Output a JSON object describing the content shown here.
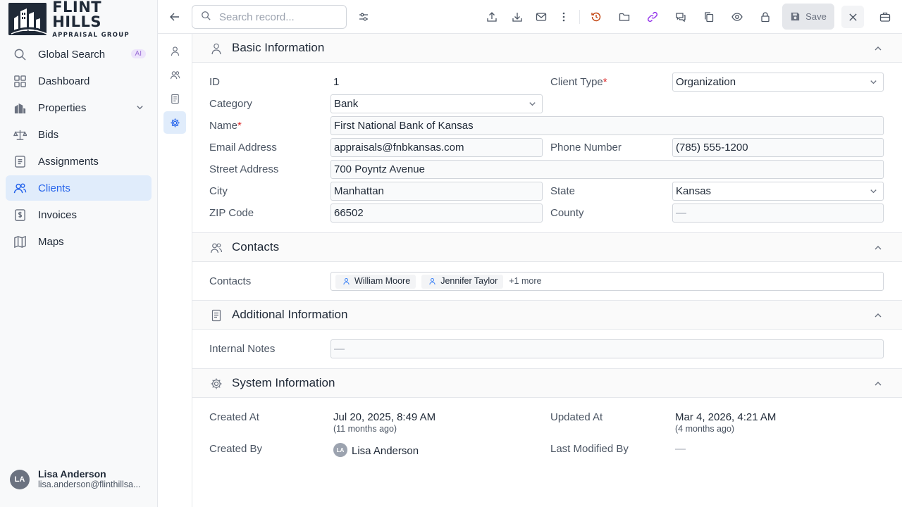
{
  "brand": {
    "title": "FLINT HILLS",
    "subtitle": "APPRAISAL GROUP"
  },
  "sidebar": {
    "items": [
      {
        "label": "Global Search",
        "icon": "search-icon",
        "badge": "AI"
      },
      {
        "label": "Dashboard",
        "icon": "dashboard-icon"
      },
      {
        "label": "Properties",
        "icon": "building-icon",
        "expandable": true
      },
      {
        "label": "Bids",
        "icon": "scale-icon"
      },
      {
        "label": "Assignments",
        "icon": "clipboard-icon"
      },
      {
        "label": "Clients",
        "icon": "users-icon",
        "active": true
      },
      {
        "label": "Invoices",
        "icon": "invoice-icon"
      },
      {
        "label": "Maps",
        "icon": "map-icon"
      }
    ],
    "user": {
      "initials": "LA",
      "name": "Lisa Anderson",
      "email": "lisa.anderson@flinthillsa..."
    }
  },
  "toolbar": {
    "search_placeholder": "Search record...",
    "save_label": "Save",
    "accent_history": "#c2410c",
    "accent_link": "#9333ea"
  },
  "sections": {
    "basic": {
      "title": "Basic Information",
      "id_label": "ID",
      "id_value": "1",
      "client_type_label": "Client Type",
      "client_type_value": "Organization",
      "category_label": "Category",
      "category_value": "Bank",
      "name_label": "Name",
      "name_value": "First National Bank of Kansas",
      "email_label": "Email Address",
      "email_value": "appraisals@fnbkansas.com",
      "phone_label": "Phone Number",
      "phone_value": "(785) 555-1200",
      "street_label": "Street Address",
      "street_value": "700 Poyntz Avenue",
      "city_label": "City",
      "city_value": "Manhattan",
      "state_label": "State",
      "state_value": "Kansas",
      "zip_label": "ZIP Code",
      "zip_value": "66502",
      "county_label": "County",
      "county_value": "—"
    },
    "contacts": {
      "title": "Contacts",
      "label": "Contacts",
      "chips": [
        "William Moore",
        "Jennifer Taylor"
      ],
      "more": "+1 more"
    },
    "additional": {
      "title": "Additional Information",
      "notes_label": "Internal Notes",
      "notes_value": "—"
    },
    "system": {
      "title": "System Information",
      "created_at_label": "Created At",
      "created_at_value": "Jul 20, 2025, 8:49 AM",
      "created_at_rel": "(11 months ago)",
      "updated_at_label": "Updated At",
      "updated_at_value": "Mar 4, 2026, 4:21 AM",
      "updated_at_rel": "(4 months ago)",
      "created_by_label": "Created By",
      "created_by_initials": "LA",
      "created_by_value": "Lisa Anderson",
      "modified_by_label": "Last Modified By",
      "modified_by_value": "—"
    }
  }
}
